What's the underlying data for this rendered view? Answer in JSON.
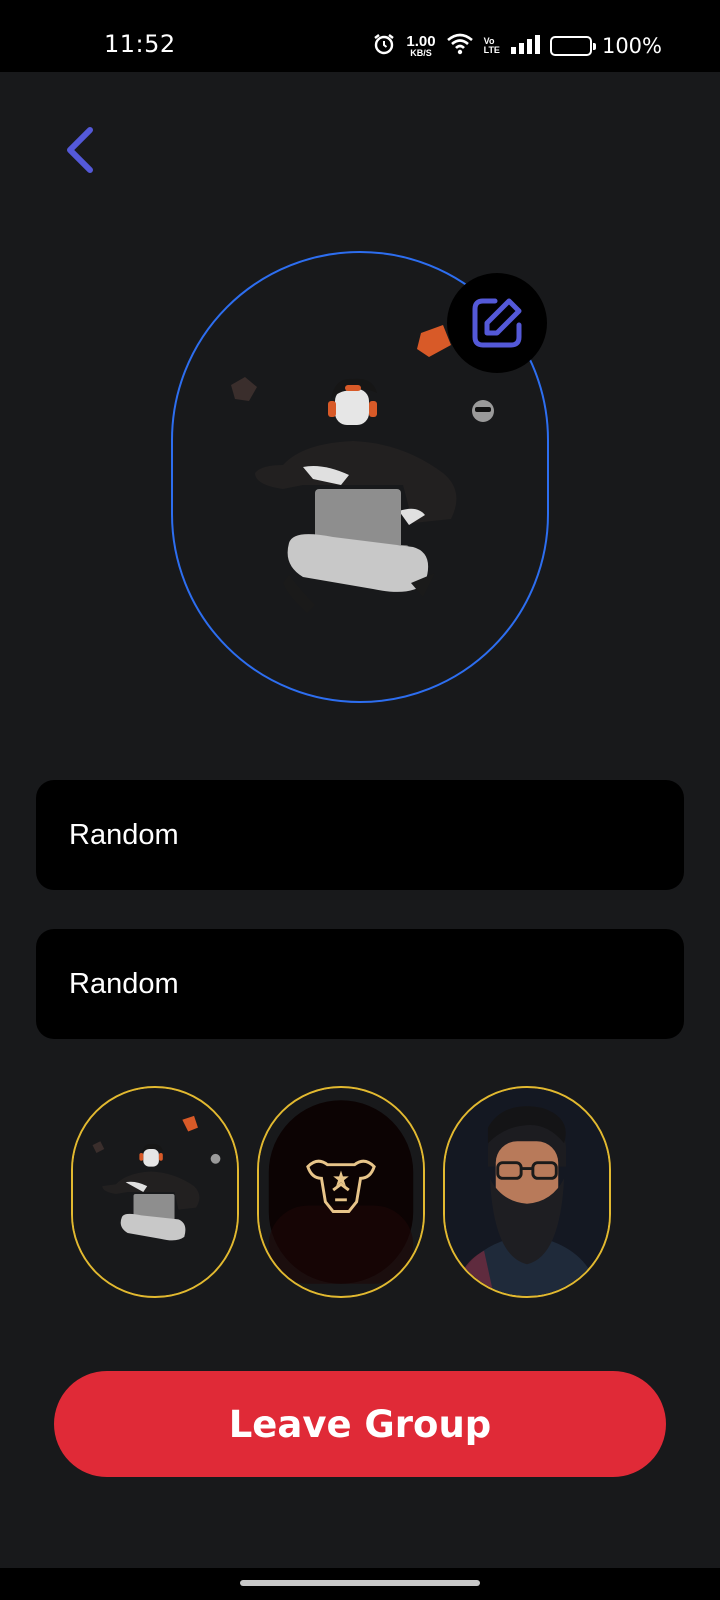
{
  "status_bar": {
    "time": "11:52",
    "net_speed_value": "1.00",
    "net_speed_unit": "KB/S",
    "volte_top": "Vo",
    "volte_bottom": "LTE",
    "battery_percent": "100%",
    "battery_level": 1.0,
    "icons": [
      "alarm-icon",
      "wifi-icon",
      "signal-icon",
      "battery-icon"
    ]
  },
  "header": {
    "back_icon": "chevron-left-icon",
    "accent_color": "#5459d8"
  },
  "group_avatar": {
    "frame_color": "#2d6ef0",
    "edit_icon": "edit-icon"
  },
  "form": {
    "name_value": "Random",
    "description_value": "Random"
  },
  "avatar_options": {
    "border_color": "#e2b930",
    "items": [
      "avatar-option-3d-character",
      "avatar-option-bull-emblem",
      "avatar-option-bearded-man"
    ]
  },
  "actions": {
    "leave_label": "Leave Group",
    "leave_color": "#e02a37"
  }
}
